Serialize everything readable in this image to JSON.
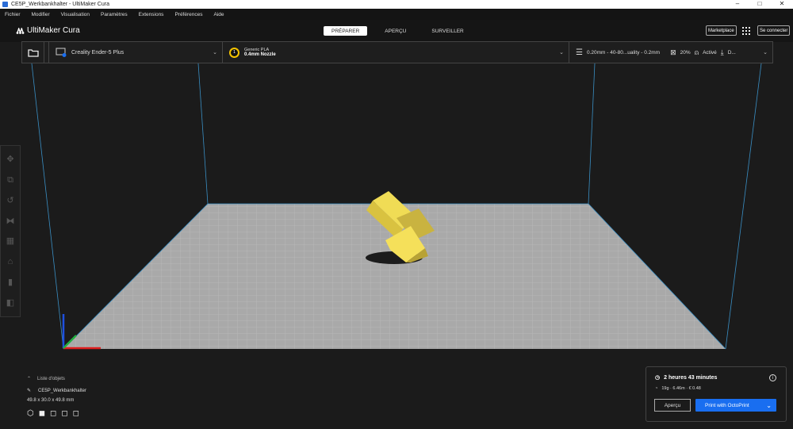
{
  "window": {
    "title": "CE5P_Werkbankhalter - UltiMaker Cura",
    "controls": [
      "–",
      "□",
      "✕"
    ]
  },
  "menu": [
    "Fichier",
    "Modifier",
    "Visualisation",
    "Paramètres",
    "Extensions",
    "Préférences",
    "Aide"
  ],
  "header": {
    "logo": "UltiMaker Cura",
    "tabs": [
      "PRÉPARER",
      "APERÇU",
      "SURVEILLER"
    ],
    "marketplace": "Marketplace",
    "signin": "Se connecter"
  },
  "stage": {
    "printer": "Creality Ender-5 Plus",
    "material": "Generic PLA",
    "nozzle": "0.4mm Nozzle",
    "extruder_number": "1",
    "profile": "0.20mm - 40-80...uality - 0.2mm",
    "infill": "20%",
    "support": "Activé",
    "adhesion": "D..."
  },
  "objects": {
    "header": "Liste d'objets",
    "name": "CE5P_Werkbankhalter",
    "dimensions": "49.8 x 30.0 x 49.8 mm"
  },
  "job": {
    "time": "2 heures 43 minutes",
    "material": "19g · 6.46m · € 0.48",
    "preview": "Aperçu",
    "print": "Print with OctoPrint"
  },
  "colors": {
    "accent": "#196ef0",
    "model": "#f5e05a"
  }
}
